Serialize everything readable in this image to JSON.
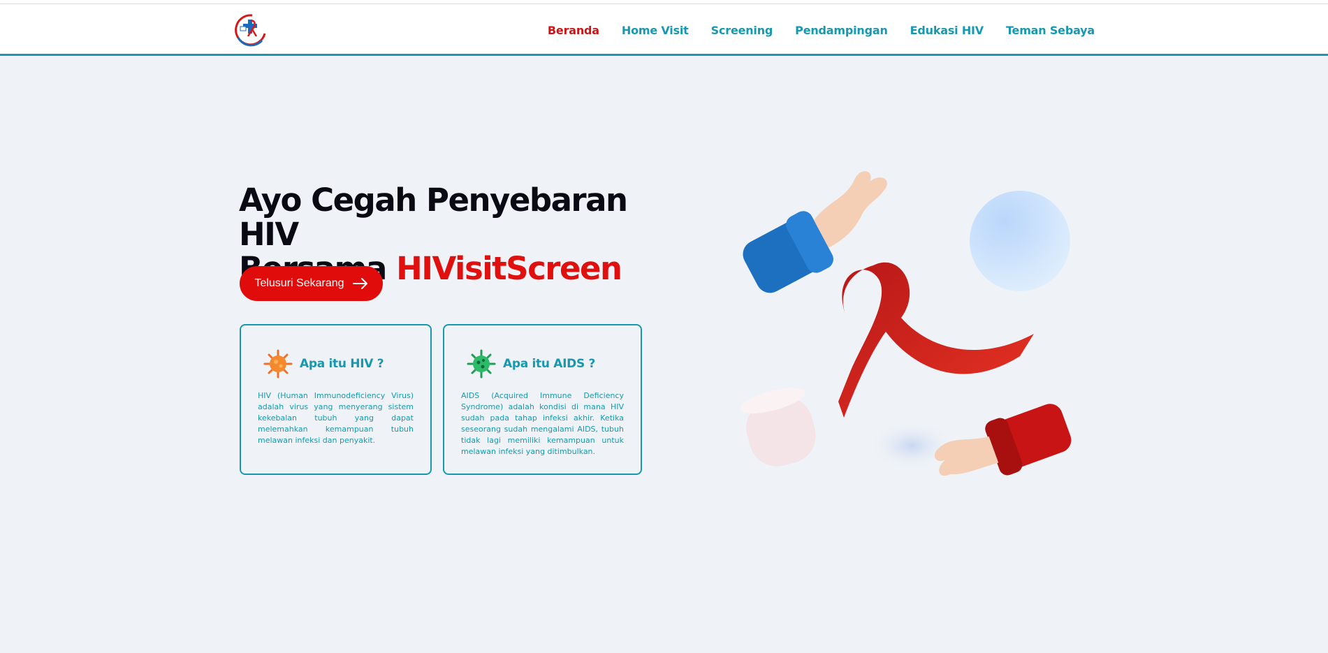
{
  "brand": {
    "logo_icon": "hiv-ribbon-logo-icon"
  },
  "nav": {
    "items": [
      {
        "label": "Beranda",
        "active": true
      },
      {
        "label": "Home Visit",
        "active": false
      },
      {
        "label": "Screening",
        "active": false
      },
      {
        "label": "Pendampingan",
        "active": false
      },
      {
        "label": "Edukasi HIV",
        "active": false
      },
      {
        "label": "Teman Sebaya",
        "active": false
      }
    ]
  },
  "hero": {
    "title_line1": "Ayo Cegah Penyebaran HIV",
    "title_line2_prefix": "Bersama ",
    "title_brand": "HIVisitScreen",
    "cta_label": "Telusuri Sekarang",
    "cta_icon": "arrow-right-icon"
  },
  "cards": [
    {
      "icon": "virus-orange-icon",
      "title": "Apa itu HIV ?",
      "text": "HIV (Human Immunodeficiency Virus) adalah virus yang menyerang sistem kekebalan tubuh yang dapat melemahkan kemampuan tubuh melawan infeksi dan penyakit."
    },
    {
      "icon": "virus-green-icon",
      "title": "Apa itu AIDS ?",
      "text": "AIDS (Acquired Immune Deficiency Syndrome) adalah kondisi di mana HIV sudah pada tahap infeksi akhir. Ketika seseorang sudah mengalami AIDS, tubuh tidak lagi memiliki kemampuan untuk melawan infeksi yang ditimbulkan."
    }
  ],
  "illustration": {
    "icon": "hands-red-ribbon-illustration"
  },
  "colors": {
    "accent": "#1699b0",
    "brand_red": "#e00c0c",
    "background": "#eff3f7"
  }
}
